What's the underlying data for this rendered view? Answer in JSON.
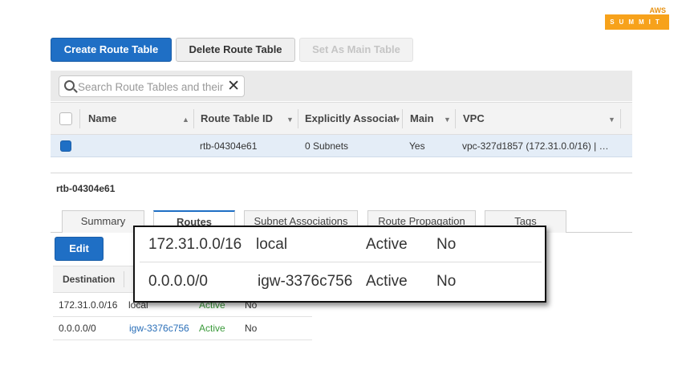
{
  "branding": {
    "aws": "AWS",
    "summit": "SUMMIT"
  },
  "toolbar": {
    "create_label": "Create Route Table",
    "delete_label": "Delete Route Table",
    "set_main_label": "Set As Main Table"
  },
  "search": {
    "placeholder": "Search Route Tables and their",
    "clear_glyph": "✕"
  },
  "table": {
    "columns": [
      "Name",
      "Route Table ID",
      "Explicitly Associat",
      "Main",
      "VPC"
    ],
    "rows": [
      {
        "name": "",
        "route_table_id": "rtb-04304e61",
        "explicitly_associated": "0 Subnets",
        "main": "Yes",
        "vpc": "vpc-327d1857 (172.31.0.0/16) | …"
      }
    ]
  },
  "detail": {
    "title": "rtb-04304e61",
    "tabs": [
      "Summary",
      "Routes",
      "Subnet Associations",
      "Route Propagation",
      "Tags"
    ],
    "active_tab": "Routes",
    "edit_label": "Edit",
    "routes_header": {
      "destination": "Destination"
    },
    "routes": [
      {
        "destination": "172.31.0.0/16",
        "target": "local",
        "status": "Active",
        "propagated": "No"
      },
      {
        "destination": "0.0.0.0/0",
        "target": "igw-3376c756",
        "status": "Active",
        "propagated": "No"
      }
    ]
  },
  "zoom_callout": {
    "rows": [
      {
        "destination": "172.31.0.0/16",
        "target": "local",
        "status": "Active",
        "propagated": "No"
      },
      {
        "destination": "0.0.0.0/0",
        "target": "igw-3376c756",
        "status": "Active",
        "propagated": "No"
      }
    ]
  },
  "colors": {
    "primary": "#1f6fc5",
    "selected_row": "#e4edf7",
    "active_status": "#3a9a3a",
    "link": "#2a6fb8",
    "summit_orange": "#f7a21b"
  }
}
